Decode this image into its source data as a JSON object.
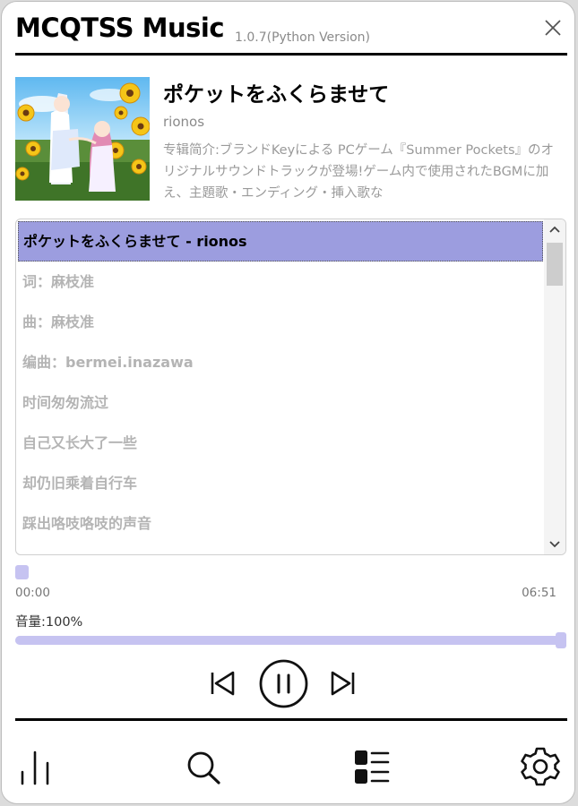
{
  "window": {
    "app_name": "MCQTSS Music",
    "version": "1.0.7(Python Version)"
  },
  "now_playing": {
    "title": "ポケットをふくらませて",
    "artist": "rionos",
    "album_intro": "专辑简介:ブランドKeyによる PCゲーム『Summer Pockets』のオリジナルサウンドトラックが登場!ゲーム内で使用されたBGMに加え、主題歌・エンディング・挿入歌な"
  },
  "lyrics": {
    "lines": [
      "ポケットをふくらませて - rionos",
      "词：麻枝准",
      "曲：麻枝准",
      "编曲：bermei.inazawa",
      "时间匆匆流过",
      "自己又长大了一些",
      "却仍旧乘着自行车",
      "踩出咯吱咯吱的声音"
    ],
    "current_index": 0
  },
  "playback": {
    "current_time": "00:00",
    "total_time": "06:51",
    "progress": 0.0,
    "volume_label": "音量:100%",
    "volume": 1.0,
    "state": "playing"
  },
  "icons": {
    "close": "close-icon",
    "prev": "skip-previous-icon",
    "pause": "pause-icon",
    "next": "skip-next-icon",
    "equalizer": "equalizer-icon",
    "search": "search-icon",
    "playlist": "playlist-icon",
    "settings": "gear-icon"
  },
  "colors": {
    "accent": "#9c9ddf",
    "slider": "#c6c3f1",
    "slider_track": "#e4e2f9",
    "muted_text": "#b4b4b4"
  }
}
